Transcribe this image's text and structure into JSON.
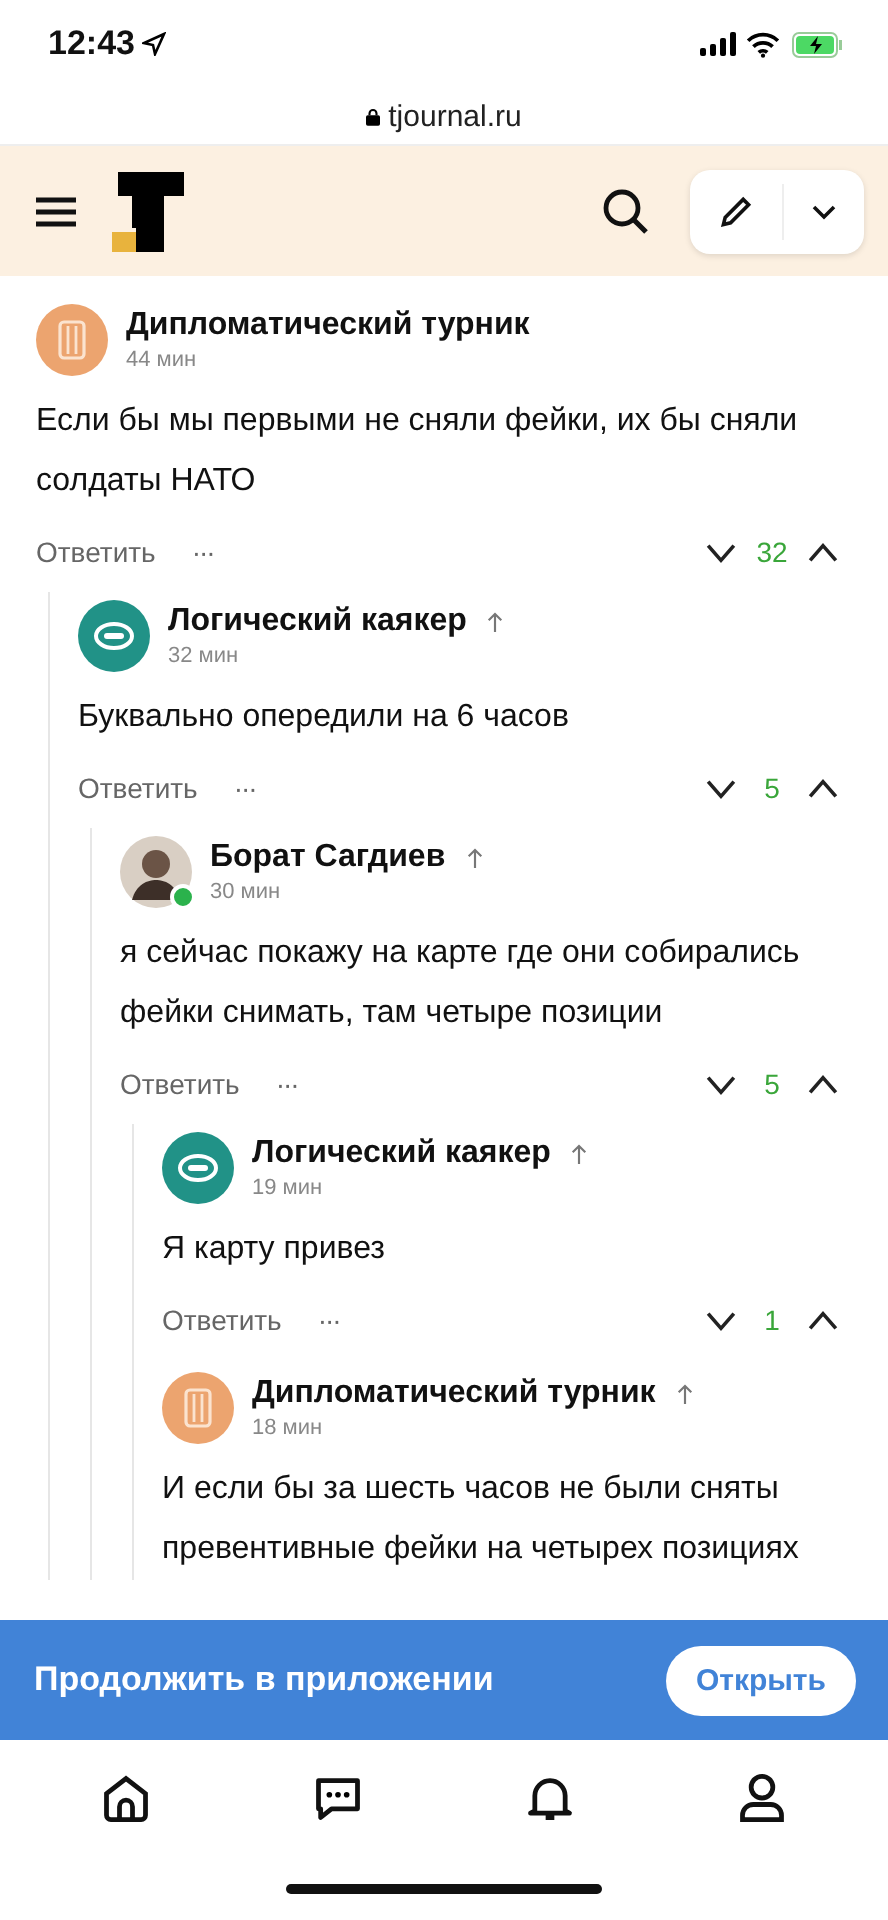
{
  "status_bar": {
    "time": "12:43"
  },
  "url_bar": {
    "domain": "tjournal.ru"
  },
  "comments": [
    {
      "author": "Дипломатический турник",
      "time": "44 мин",
      "avatar": {
        "kind": "pattern"
      },
      "online": false,
      "reply_arrow": false,
      "text": "Если бы мы первыми не сняли фейки, их бы сняли солдаты НАТО",
      "reply_label": "Ответить",
      "more": "···",
      "votes": "32",
      "children": [
        {
          "author": "Логический каякер",
          "time": "32 мин",
          "avatar": {
            "kind": "eye"
          },
          "online": false,
          "reply_arrow": true,
          "text": "Буквально опередили на 6 часов",
          "reply_label": "Ответить",
          "more": "···",
          "votes": "5",
          "children": [
            {
              "author": "Борат Сагдиев",
              "time": "30 мин",
              "avatar": {
                "kind": "photo"
              },
              "online": true,
              "reply_arrow": true,
              "text": "я сейчас покажу на карте где они собирались фейки снимать, там четыре позиции",
              "reply_label": "Ответить",
              "more": "···",
              "votes": "5",
              "children": [
                {
                  "author": "Логический каякер",
                  "time": "19 мин",
                  "avatar": {
                    "kind": "eye"
                  },
                  "online": false,
                  "reply_arrow": true,
                  "text": "Я карту привез",
                  "reply_label": "Ответить",
                  "more": "···",
                  "votes": "1"
                },
                {
                  "author": "Дипломатический турник",
                  "time": "18 мин",
                  "avatar": {
                    "kind": "pattern"
                  },
                  "online": false,
                  "reply_arrow": true,
                  "text": "И если бы за шесть часов не были сняты превентивные фейки на четырех позициях"
                }
              ]
            }
          ]
        }
      ]
    }
  ],
  "banner": {
    "text": "Продолжить в приложении",
    "button": "Открыть"
  }
}
